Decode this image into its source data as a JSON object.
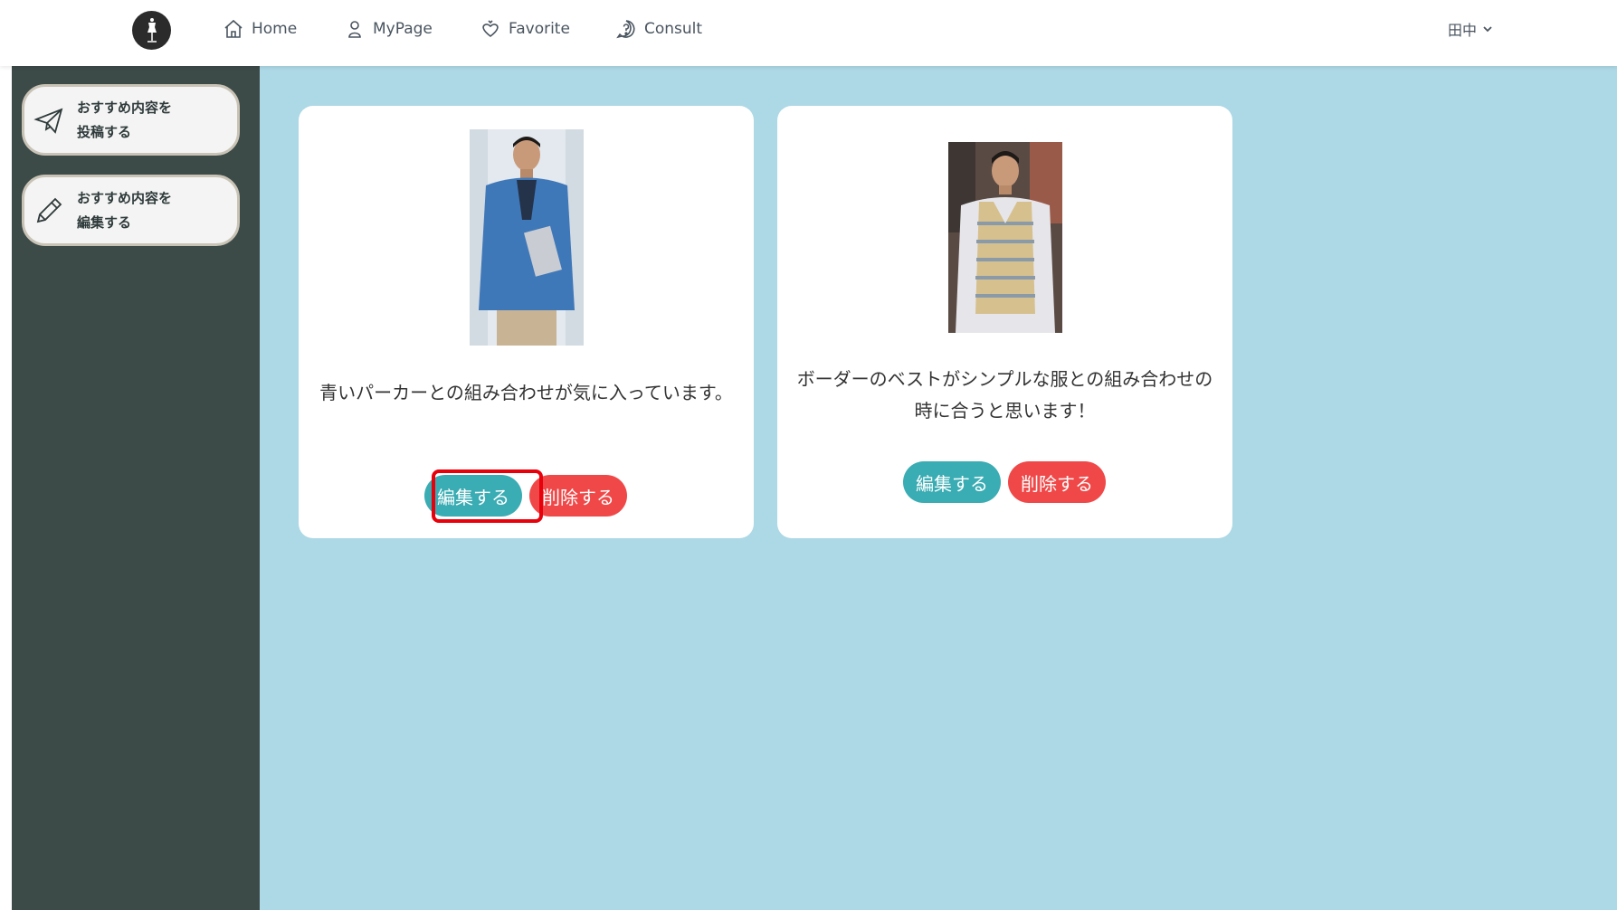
{
  "nav": {
    "items": [
      {
        "label": "Home",
        "icon": "home-icon"
      },
      {
        "label": "MyPage",
        "icon": "user-icon"
      },
      {
        "label": "Favorite",
        "icon": "heart-icon"
      },
      {
        "label": "Consult",
        "icon": "question-icon"
      }
    ],
    "user_name": "田中"
  },
  "sidebar": {
    "items": [
      {
        "label": "おすすめ内容を\n投稿する",
        "icon": "paper-plane-icon"
      },
      {
        "label": "おすすめ内容を\n編集する",
        "icon": "pencil-icon"
      }
    ]
  },
  "cards": [
    {
      "text": "青いパーカーとの組み合わせが気に入っています。",
      "edit_label": "編集する",
      "delete_label": "削除する"
    },
    {
      "text": "ボーダーのベストがシンプルな服との組み合わせの時に合うと思います！",
      "edit_label": "編集する",
      "delete_label": "削除する"
    }
  ],
  "colors": {
    "main_bg": "#add8e6",
    "sidebar_bg": "#3c4a48",
    "edit_button": "#3aacb3",
    "delete_button": "#f04848",
    "highlight": "#e8000b"
  }
}
